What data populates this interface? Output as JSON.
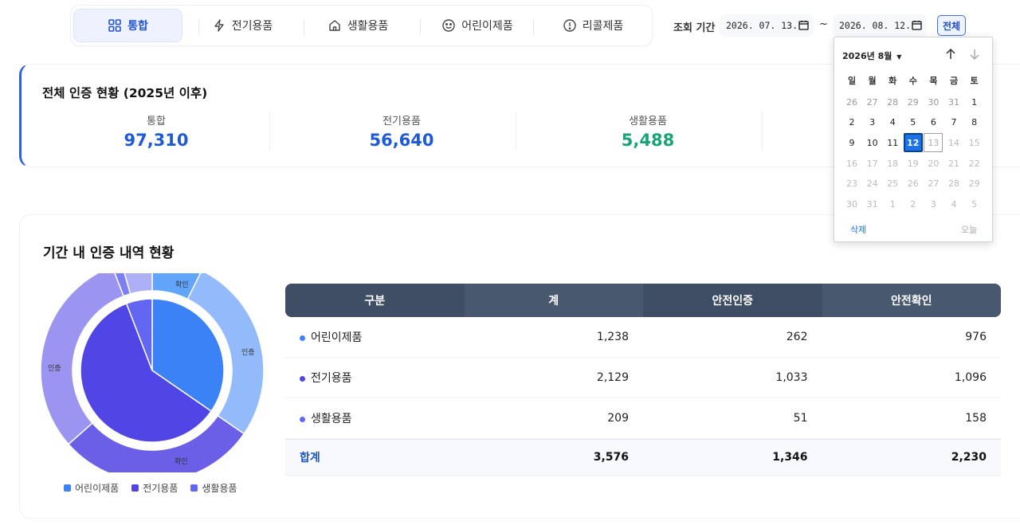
{
  "nav": {
    "tabs": [
      {
        "label": "통합",
        "icon": "grid-icon"
      },
      {
        "label": "전기용품",
        "icon": "lightning-icon"
      },
      {
        "label": "생활용품",
        "icon": "home-icon"
      },
      {
        "label": "어린이제품",
        "icon": "smiley-icon"
      },
      {
        "label": "리콜제품",
        "icon": "alert-circle-icon"
      }
    ],
    "active": "통합"
  },
  "period": {
    "label": "조회 기간",
    "start": "2026. 07. 13.",
    "end": "2026. 08. 12.",
    "separator": "~",
    "all_button": "전체"
  },
  "summary": {
    "title": "전체 인증 현황 (2025년 이후)",
    "stats": [
      {
        "label": "통합",
        "value": "97,310",
        "color": "#1d5ad8"
      },
      {
        "label": "전기용품",
        "value": "56,640",
        "color": "#1d5ad8"
      },
      {
        "label": "생활용품",
        "value": "5,488",
        "color": "#17a673"
      }
    ]
  },
  "section": {
    "title": "기간 내 인증 내역 현황"
  },
  "chart_data": {
    "type": "pie",
    "inner": [
      {
        "name": "어린이제품",
        "value": 1238,
        "color": "#3b82f6"
      },
      {
        "name": "전기용품",
        "value": 2129,
        "color": "#4f46e5"
      },
      {
        "name": "생활용품",
        "value": 209,
        "color": "#6366f1"
      }
    ],
    "outer": [
      {
        "group": "어린이제품",
        "name": "인증",
        "value": 262,
        "color": "#60a5fa"
      },
      {
        "group": "어린이제품",
        "name": "확인",
        "value": 976,
        "color": "#93bbfb"
      },
      {
        "group": "전기용품",
        "name": "인증",
        "value": 1033,
        "color": "#6a5fe6"
      },
      {
        "group": "전기용품",
        "name": "확인",
        "value": 1096,
        "color": "#9b94f0"
      },
      {
        "group": "생활용품",
        "name": "인증",
        "value": 51,
        "color": "#7c7ff3"
      },
      {
        "group": "생활용품",
        "name": "확인",
        "value": 158,
        "color": "#aeb0f7"
      }
    ],
    "labels": [
      "확인",
      "인증",
      "인증",
      "확인"
    ],
    "legend": [
      {
        "name": "어린이제품",
        "color": "#3b82f6"
      },
      {
        "name": "전기용품",
        "color": "#4f46e5"
      },
      {
        "name": "생활용품",
        "color": "#6366f1"
      }
    ]
  },
  "table": {
    "headers": [
      "구분",
      "계",
      "안전인증",
      "안전확인"
    ],
    "rows": [
      {
        "name": "어린이제품",
        "total": "1,238",
        "cert": "262",
        "confirm": "976",
        "color": "#3b82f6"
      },
      {
        "name": "전기용품",
        "total": "2,129",
        "cert": "1,033",
        "confirm": "1,096",
        "color": "#4f46e5"
      },
      {
        "name": "생활용품",
        "total": "209",
        "cert": "51",
        "confirm": "158",
        "color": "#6366f1"
      }
    ],
    "sum": {
      "name": "합계",
      "total": "3,576",
      "cert": "1,346",
      "confirm": "2,230"
    }
  },
  "calendar": {
    "month_label": "2026년 8월",
    "weekdays": [
      "일",
      "월",
      "화",
      "수",
      "목",
      "금",
      "토"
    ],
    "weeks": [
      [
        "26",
        "27",
        "28",
        "29",
        "30",
        "31",
        "1"
      ],
      [
        "2",
        "3",
        "4",
        "5",
        "6",
        "7",
        "8"
      ],
      [
        "9",
        "10",
        "11",
        "12",
        "13",
        "14",
        "15"
      ],
      [
        "16",
        "17",
        "18",
        "19",
        "20",
        "21",
        "22"
      ],
      [
        "23",
        "24",
        "25",
        "26",
        "27",
        "28",
        "29"
      ],
      [
        "30",
        "31",
        "1",
        "2",
        "3",
        "4",
        "5"
      ]
    ],
    "selected": "12",
    "today": "13",
    "clear_label": "삭제",
    "today_label": "오늘"
  }
}
